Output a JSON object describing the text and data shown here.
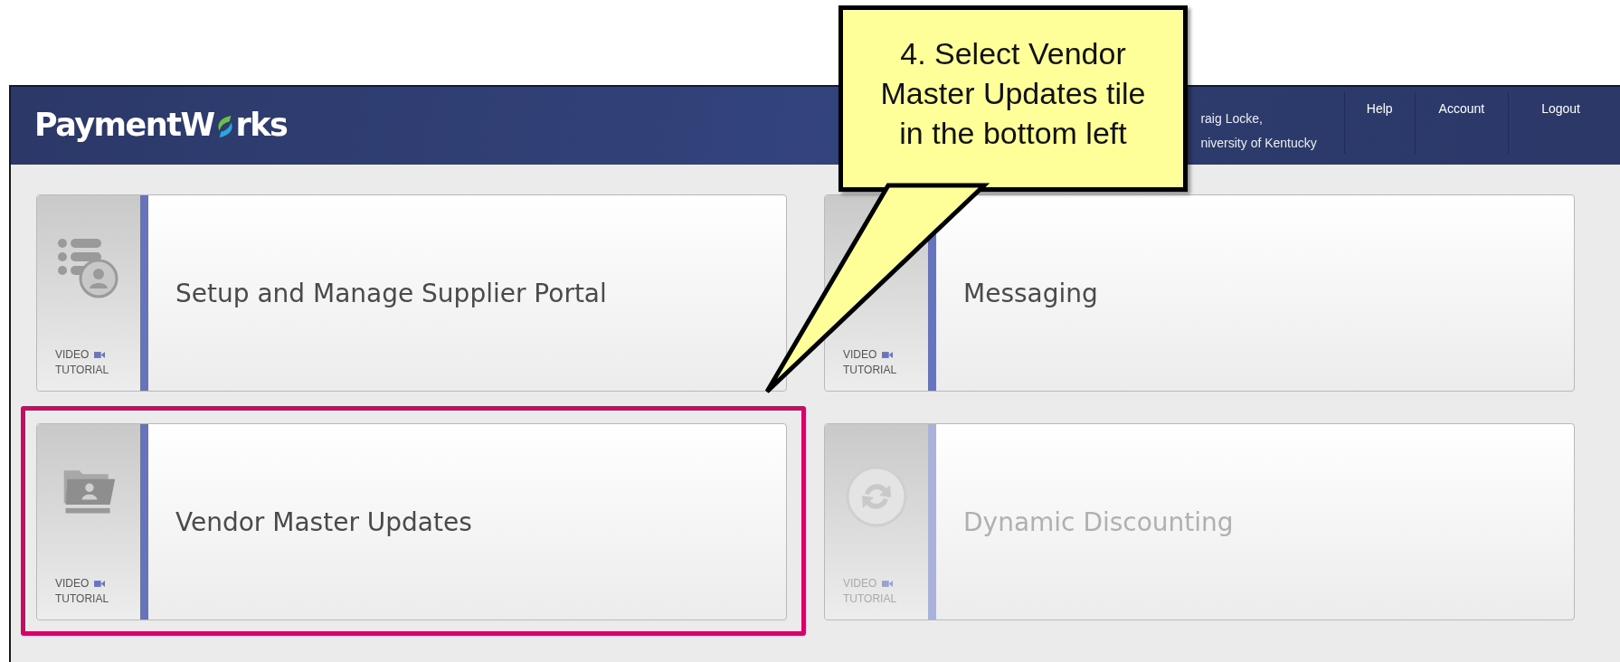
{
  "header": {
    "logo": {
      "before": "PaymentW",
      "after": "rks"
    },
    "user_lines": [
      "raig Locke,",
      "niversity of Kentucky"
    ],
    "nav": [
      {
        "label": "Help"
      },
      {
        "label": "Account"
      },
      {
        "label": "Logout"
      }
    ]
  },
  "tiles": [
    {
      "title": "Setup and Manage Supplier Portal",
      "kind": "list-user",
      "video_label": "VIDEO",
      "tutorial_label": "TUTORIAL",
      "disabled": false,
      "highlighted": false
    },
    {
      "title": "Messaging",
      "video_label": "VIDEO",
      "tutorial_label": "TUTORIAL",
      "disabled": false,
      "highlighted": false
    },
    {
      "title": "Vendor Master Updates",
      "kind": "folder-user",
      "video_label": "VIDEO",
      "tutorial_label": "TUTORIAL",
      "disabled": false,
      "highlighted": true
    },
    {
      "title": "Dynamic Discounting",
      "kind": "sync",
      "video_label": "VIDEO",
      "tutorial_label": "TUTORIAL",
      "disabled": true,
      "highlighted": false
    }
  ],
  "callout": {
    "text": "4. Select Vendor Master Updates tile in the bottom left"
  }
}
